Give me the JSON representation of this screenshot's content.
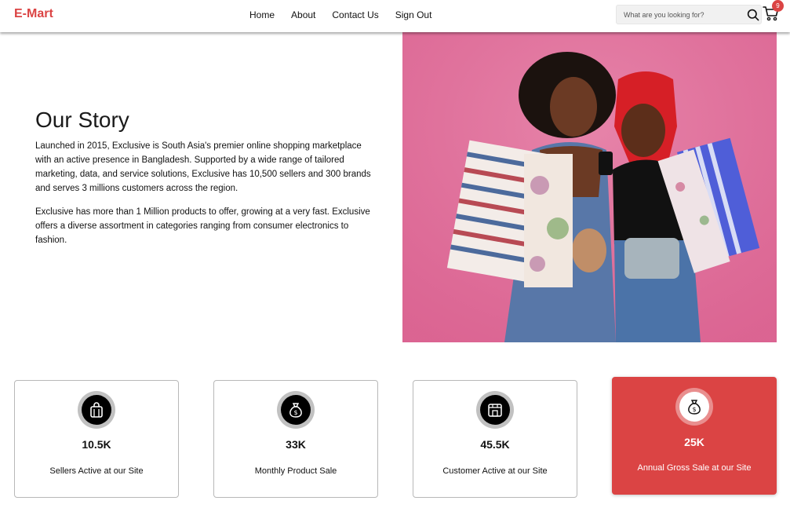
{
  "header": {
    "logo": "E-Mart",
    "nav": [
      "Home",
      "About",
      "Contact Us",
      "Sign Out"
    ],
    "search": {
      "placeholder": "What are you looking for?",
      "value": ""
    },
    "cart_count": "9"
  },
  "story": {
    "title": "Our Story",
    "paragraph_1": "Launched in 2015, Exclusive is South Asia's premier online shopping marketplace with an active presence in Bangladesh. Supported by a wide range of tailored marketing, data, and service solutions, Exclusive has 10,500 sellers and 300 brands and serves 3 millions customers across the region.",
    "paragraph_2": "Exclusive has more than 1 Million products to offer, growing at a very fast. Exclusive offers a diverse assortment in categories ranging from consumer electronics to fashion."
  },
  "stats": [
    {
      "icon": "shopping-bag-icon",
      "value": "10.5K",
      "label": "Sellers Active at our Site"
    },
    {
      "icon": "money-bag-icon",
      "value": "33K",
      "label": "Monthly Product Sale"
    },
    {
      "icon": "storefront-icon",
      "value": "45.5K",
      "label": "Customer Active at our Site"
    },
    {
      "icon": "money-bag-icon",
      "value": "25K",
      "label": "Annual Gross Sale at our Site"
    }
  ],
  "colors": {
    "accent": "#db4444",
    "hero_bg": "#e0709c"
  }
}
